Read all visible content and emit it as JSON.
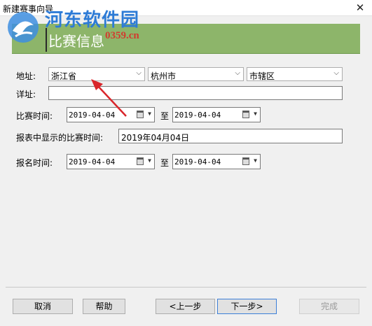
{
  "window": {
    "title": "新建赛事向导",
    "close_glyph": "✕"
  },
  "watermark": {
    "name": "河东软件园",
    "url": "0359.cn"
  },
  "banner": {
    "title": "比赛信息"
  },
  "form": {
    "address_label": "地址:",
    "province": "浙江省",
    "city": "杭州市",
    "district": "市辖区",
    "detail_label": "详址:",
    "detail_value": "",
    "match_time_label": "比赛时间:",
    "match_start": "2019-04-04",
    "to_label_1": "至",
    "match_end": "2019-04-04",
    "display_time_label": "报表中显示的比赛时间:",
    "display_time_value": "2019年04月04日",
    "signup_time_label": "报名时间:",
    "signup_start": "2019-04-04",
    "to_label_2": "至",
    "signup_end": "2019-04-04"
  },
  "buttons": {
    "cancel": "取消",
    "help": "帮助",
    "prev": "<上一步",
    "next": "下一步>",
    "finish": "完成"
  },
  "colors": {
    "banner_bg": "#8db56a",
    "annotation_arrow": "#d9262b"
  }
}
